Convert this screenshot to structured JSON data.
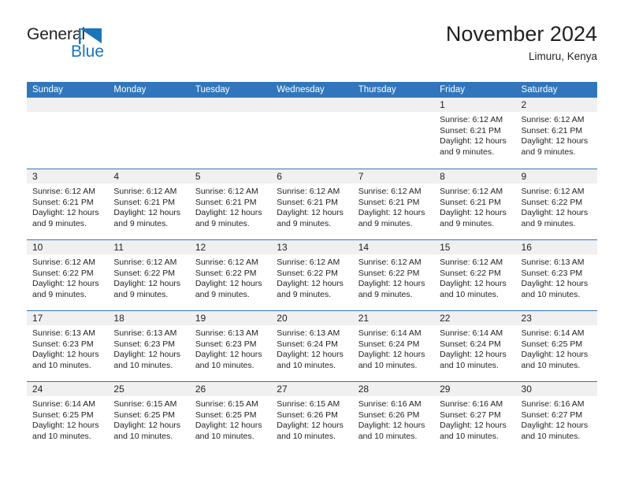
{
  "logo": {
    "word_one": "General",
    "word_two": "Blue",
    "flag_icon": "triangle-flag-icon",
    "blue_hex": "#1b75bb"
  },
  "header": {
    "title": "November 2024",
    "location": "Limuru, Kenya"
  },
  "theme": {
    "header_blue": "#3176bc",
    "day_band_gray": "#f0f0f0",
    "text": "#231f20"
  },
  "weekdays": [
    "Sunday",
    "Monday",
    "Tuesday",
    "Wednesday",
    "Thursday",
    "Friday",
    "Saturday"
  ],
  "weeks": [
    [
      {
        "day": "",
        "lines": []
      },
      {
        "day": "",
        "lines": []
      },
      {
        "day": "",
        "lines": []
      },
      {
        "day": "",
        "lines": []
      },
      {
        "day": "",
        "lines": []
      },
      {
        "day": "1",
        "lines": [
          "Sunrise: 6:12 AM",
          "Sunset: 6:21 PM",
          "Daylight: 12 hours",
          "and 9 minutes."
        ]
      },
      {
        "day": "2",
        "lines": [
          "Sunrise: 6:12 AM",
          "Sunset: 6:21 PM",
          "Daylight: 12 hours",
          "and 9 minutes."
        ]
      }
    ],
    [
      {
        "day": "3",
        "lines": [
          "Sunrise: 6:12 AM",
          "Sunset: 6:21 PM",
          "Daylight: 12 hours",
          "and 9 minutes."
        ]
      },
      {
        "day": "4",
        "lines": [
          "Sunrise: 6:12 AM",
          "Sunset: 6:21 PM",
          "Daylight: 12 hours",
          "and 9 minutes."
        ]
      },
      {
        "day": "5",
        "lines": [
          "Sunrise: 6:12 AM",
          "Sunset: 6:21 PM",
          "Daylight: 12 hours",
          "and 9 minutes."
        ]
      },
      {
        "day": "6",
        "lines": [
          "Sunrise: 6:12 AM",
          "Sunset: 6:21 PM",
          "Daylight: 12 hours",
          "and 9 minutes."
        ]
      },
      {
        "day": "7",
        "lines": [
          "Sunrise: 6:12 AM",
          "Sunset: 6:21 PM",
          "Daylight: 12 hours",
          "and 9 minutes."
        ]
      },
      {
        "day": "8",
        "lines": [
          "Sunrise: 6:12 AM",
          "Sunset: 6:21 PM",
          "Daylight: 12 hours",
          "and 9 minutes."
        ]
      },
      {
        "day": "9",
        "lines": [
          "Sunrise: 6:12 AM",
          "Sunset: 6:22 PM",
          "Daylight: 12 hours",
          "and 9 minutes."
        ]
      }
    ],
    [
      {
        "day": "10",
        "lines": [
          "Sunrise: 6:12 AM",
          "Sunset: 6:22 PM",
          "Daylight: 12 hours",
          "and 9 minutes."
        ]
      },
      {
        "day": "11",
        "lines": [
          "Sunrise: 6:12 AM",
          "Sunset: 6:22 PM",
          "Daylight: 12 hours",
          "and 9 minutes."
        ]
      },
      {
        "day": "12",
        "lines": [
          "Sunrise: 6:12 AM",
          "Sunset: 6:22 PM",
          "Daylight: 12 hours",
          "and 9 minutes."
        ]
      },
      {
        "day": "13",
        "lines": [
          "Sunrise: 6:12 AM",
          "Sunset: 6:22 PM",
          "Daylight: 12 hours",
          "and 9 minutes."
        ]
      },
      {
        "day": "14",
        "lines": [
          "Sunrise: 6:12 AM",
          "Sunset: 6:22 PM",
          "Daylight: 12 hours",
          "and 9 minutes."
        ]
      },
      {
        "day": "15",
        "lines": [
          "Sunrise: 6:12 AM",
          "Sunset: 6:22 PM",
          "Daylight: 12 hours",
          "and 10 minutes."
        ]
      },
      {
        "day": "16",
        "lines": [
          "Sunrise: 6:13 AM",
          "Sunset: 6:23 PM",
          "Daylight: 12 hours",
          "and 10 minutes."
        ]
      }
    ],
    [
      {
        "day": "17",
        "lines": [
          "Sunrise: 6:13 AM",
          "Sunset: 6:23 PM",
          "Daylight: 12 hours",
          "and 10 minutes."
        ]
      },
      {
        "day": "18",
        "lines": [
          "Sunrise: 6:13 AM",
          "Sunset: 6:23 PM",
          "Daylight: 12 hours",
          "and 10 minutes."
        ]
      },
      {
        "day": "19",
        "lines": [
          "Sunrise: 6:13 AM",
          "Sunset: 6:23 PM",
          "Daylight: 12 hours",
          "and 10 minutes."
        ]
      },
      {
        "day": "20",
        "lines": [
          "Sunrise: 6:13 AM",
          "Sunset: 6:24 PM",
          "Daylight: 12 hours",
          "and 10 minutes."
        ]
      },
      {
        "day": "21",
        "lines": [
          "Sunrise: 6:14 AM",
          "Sunset: 6:24 PM",
          "Daylight: 12 hours",
          "and 10 minutes."
        ]
      },
      {
        "day": "22",
        "lines": [
          "Sunrise: 6:14 AM",
          "Sunset: 6:24 PM",
          "Daylight: 12 hours",
          "and 10 minutes."
        ]
      },
      {
        "day": "23",
        "lines": [
          "Sunrise: 6:14 AM",
          "Sunset: 6:25 PM",
          "Daylight: 12 hours",
          "and 10 minutes."
        ]
      }
    ],
    [
      {
        "day": "24",
        "lines": [
          "Sunrise: 6:14 AM",
          "Sunset: 6:25 PM",
          "Daylight: 12 hours",
          "and 10 minutes."
        ]
      },
      {
        "day": "25",
        "lines": [
          "Sunrise: 6:15 AM",
          "Sunset: 6:25 PM",
          "Daylight: 12 hours",
          "and 10 minutes."
        ]
      },
      {
        "day": "26",
        "lines": [
          "Sunrise: 6:15 AM",
          "Sunset: 6:25 PM",
          "Daylight: 12 hours",
          "and 10 minutes."
        ]
      },
      {
        "day": "27",
        "lines": [
          "Sunrise: 6:15 AM",
          "Sunset: 6:26 PM",
          "Daylight: 12 hours",
          "and 10 minutes."
        ]
      },
      {
        "day": "28",
        "lines": [
          "Sunrise: 6:16 AM",
          "Sunset: 6:26 PM",
          "Daylight: 12 hours",
          "and 10 minutes."
        ]
      },
      {
        "day": "29",
        "lines": [
          "Sunrise: 6:16 AM",
          "Sunset: 6:27 PM",
          "Daylight: 12 hours",
          "and 10 minutes."
        ]
      },
      {
        "day": "30",
        "lines": [
          "Sunrise: 6:16 AM",
          "Sunset: 6:27 PM",
          "Daylight: 12 hours",
          "and 10 minutes."
        ]
      }
    ]
  ]
}
